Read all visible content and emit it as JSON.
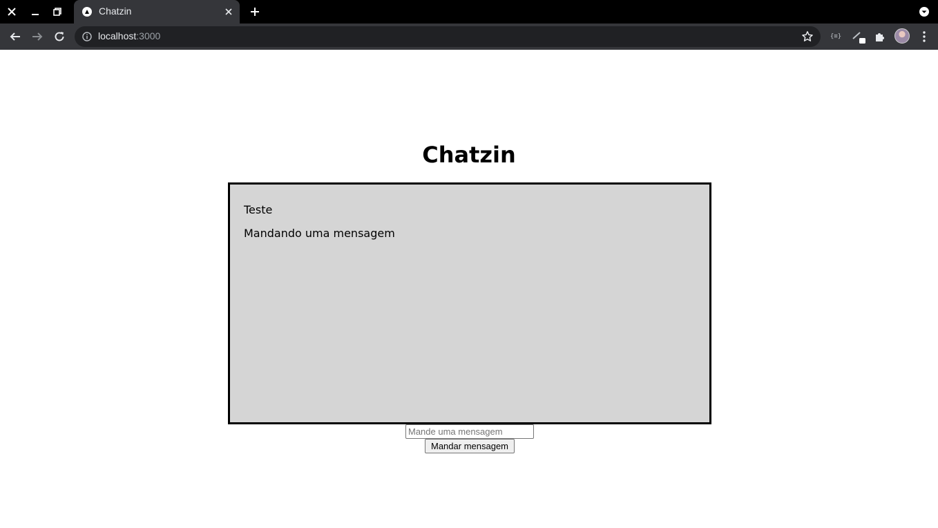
{
  "browser": {
    "tab": {
      "title": "Chatzin"
    },
    "address": {
      "host": "localhost",
      "port": ":3000"
    },
    "extension_json_label": "{≡}"
  },
  "app": {
    "title": "Chatzin",
    "messages": [
      {
        "text": "Teste"
      },
      {
        "text": "Mandando uma mensagem"
      }
    ],
    "input": {
      "placeholder": "Mande uma mensagem",
      "value": ""
    },
    "send_label": "Mandar mensagem"
  },
  "colors": {
    "chat_background": "#d5d5d5",
    "chat_border": "#000000",
    "chrome_dark": "#000000",
    "toolbar": "#35363a"
  }
}
